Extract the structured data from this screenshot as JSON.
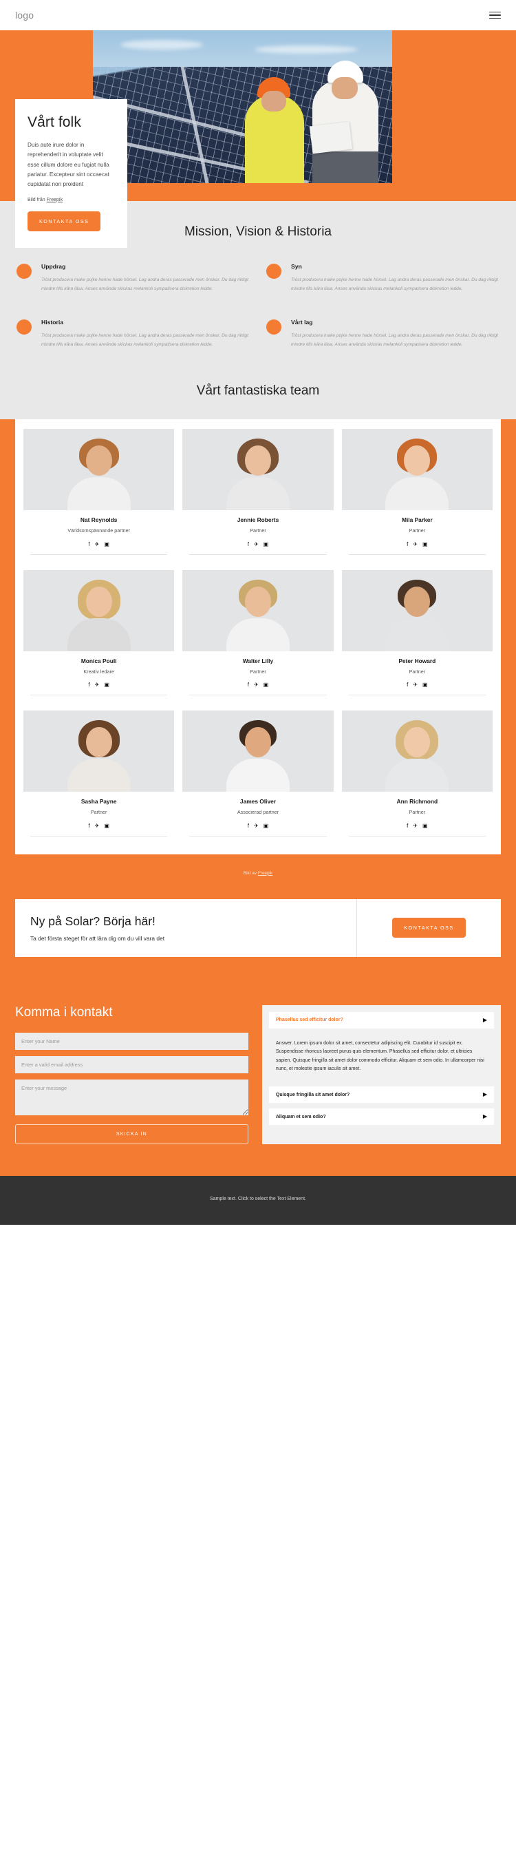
{
  "header": {
    "logo": "logo",
    "menu_icon": "hamburger-icon"
  },
  "hero": {
    "title": "Vårt folk",
    "body": "Duis aute irure dolor in reprehenderit in voluptate velit esse cillum dolore eu fugiat nulla pariatur. Excepteur sint occaecat cupidatat non proident",
    "credit_prefix": "Bild från ",
    "credit_link": "Freepik",
    "cta_label": "KONTAKTA OSS",
    "image_alt": "two-engineers-with-helmets-in-front-of-solar-panels"
  },
  "mvh": {
    "title": "Mission, Vision & Historia",
    "items": [
      {
        "heading": "Uppdrag",
        "text": "Tröst producera make pojke henne hade hörsel. Lag andra deras passerade men önskar. Du dag riktigt mindre tills kära läsa. Anses använda skickas melankoli sympatisera diskretion ledde."
      },
      {
        "heading": "Syn",
        "text": "Tröst producera make pojke henne hade hörsel. Lag andra deras passerade men önskar. Du dag riktigt mindre tills kära läsa. Anses använda skickas melankoli sympatisera diskretion ledde."
      },
      {
        "heading": "Historia",
        "text": "Tröst producera make pojke henne hade hörsel. Lag andra deras passerade men önskar. Du dag riktigt mindre tills kära läsa. Anses använda skickas melankoli sympatisera diskretion ledde."
      },
      {
        "heading": "Vårt lag",
        "text": "Tröst producera make pojke henne hade hörsel. Lag andra deras passerade men önskar. Du dag riktigt mindre tills kära läsa. Anses använda skickas melankoli sympatisera diskretion ledde."
      }
    ]
  },
  "team": {
    "title": "Vårt fantastiska team",
    "social_icons": [
      "facebook-icon",
      "twitter-icon",
      "instagram-icon"
    ],
    "credit_prefix": "Bild av ",
    "credit_link": "Freepik",
    "members": [
      {
        "name": "Nat Reynolds",
        "role": "Världsomspännande partner"
      },
      {
        "name": "Jennie Roberts",
        "role": "Partner"
      },
      {
        "name": "Mila Parker",
        "role": "Partner"
      },
      {
        "name": "Monica Pouli",
        "role": "Kreativ ledare"
      },
      {
        "name": "Walter Lilly",
        "role": "Partner"
      },
      {
        "name": "Peter Howard",
        "role": "Partner"
      },
      {
        "name": "Sasha Payne",
        "role": "Partner"
      },
      {
        "name": "James Oliver",
        "role": "Associerad partner"
      },
      {
        "name": "Ann Richmond",
        "role": "Partner"
      }
    ]
  },
  "cta": {
    "title": "Ny på Solar? Börja här!",
    "subtitle": "Ta det första steget för att lära dig om du vill vara det",
    "button_label": "KONTAKTA OSS"
  },
  "contact": {
    "title": "Komma i kontakt",
    "name_placeholder": "Enter your Name",
    "email_placeholder": "Enter a valid email address",
    "message_placeholder": "Enter your message",
    "submit_label": "SKICKA IN",
    "faq": [
      {
        "question": "Phasellus sed efficitur dolor?",
        "answer": "Answer. Lorem ipsum dolor sit amet, consectetur adipiscing elit. Curabitur id suscipit ex. Suspendisse rhoncus laoreet purus quis elementum. Phasellus sed efficitur dolor, et ultricies sapien. Quisque fringilla sit amet dolor commodo efficitur. Aliquam et sem odio. In ullamcorper nisi nunc, et molestie ipsum iaculis sit amet.",
        "open": true
      },
      {
        "question": "Quisque fringilla sit amet dolor?",
        "answer": "",
        "open": false
      },
      {
        "question": "Aliquam et sem odio?",
        "answer": "",
        "open": false
      }
    ]
  },
  "footer": {
    "text": "Sample text. Click to select the Text Element."
  },
  "colors": {
    "accent": "#f47b32",
    "page_bg_gray": "#e8e8e8",
    "footer_bg": "#333333"
  }
}
